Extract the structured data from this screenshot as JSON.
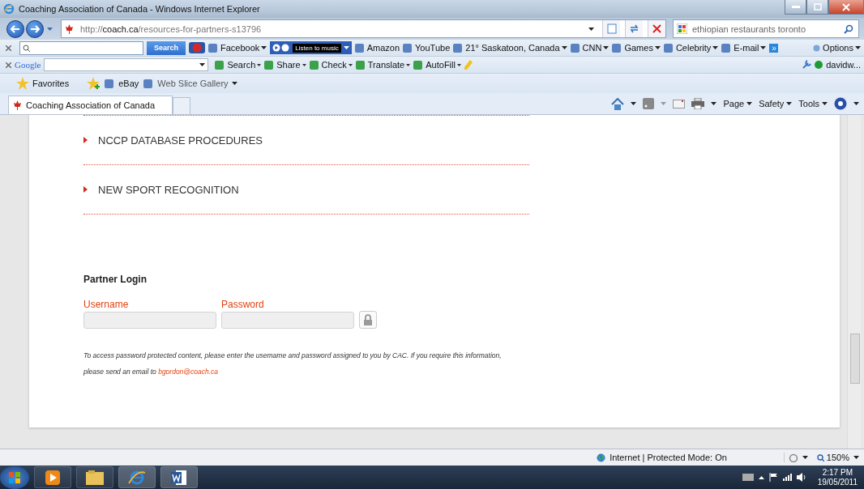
{
  "window": {
    "title": "Coaching Association of Canada - Windows Internet Explorer"
  },
  "address_bar": {
    "url_prefix": "http://",
    "url_host": "coach.ca",
    "url_path": "/resources-for-partners-s13796"
  },
  "search_box": {
    "value": "ethiopian restaurants toronto"
  },
  "toolbar_1": {
    "search_button": "Search",
    "items": [
      {
        "label": "Facebook",
        "dropdown": true
      },
      {
        "label": "Listen to music",
        "dropdown": true,
        "kind": "player"
      },
      {
        "label": "Amazon",
        "dropdown": false
      },
      {
        "label": "YouTube",
        "dropdown": false
      },
      {
        "label": "21° Saskatoon, Canada",
        "dropdown": true
      },
      {
        "label": "CNN",
        "dropdown": true
      },
      {
        "label": "Games",
        "dropdown": true
      },
      {
        "label": "Celebrity",
        "dropdown": true
      },
      {
        "label": "E-mail",
        "dropdown": true
      }
    ],
    "more": "»",
    "options": "Options"
  },
  "toolbar_2": {
    "logo": "Google",
    "items": [
      {
        "label": "Search",
        "dropdown": true
      },
      {
        "label": "Share",
        "dropdown": true
      },
      {
        "label": "Check",
        "dropdown": true
      },
      {
        "label": "Translate",
        "dropdown": true
      },
      {
        "label": "AutoFill",
        "dropdown": true
      }
    ],
    "user": "davidw..."
  },
  "favorites_bar": {
    "favorites": "Favorites",
    "items": [
      {
        "label": "eBay",
        "dropdown": false
      },
      {
        "label": "Web Slice Gallery",
        "dropdown": true
      }
    ]
  },
  "tabs": [
    {
      "label": "Coaching Association of Canada",
      "selected": true
    }
  ],
  "command_bar": [
    "Page",
    "Safety",
    "Tools"
  ],
  "content": {
    "sections": [
      "NCCP DATABASE PROCEDURES",
      "NEW SPORT RECOGNITION"
    ],
    "login": {
      "title": "Partner Login",
      "username_label": "Username",
      "password_label": "Password",
      "note": "To access password protected content, please enter the usemame and password assigned to you by CAC.  If you require this information,",
      "note_2": "please send an email to",
      "email": "bgordon@coach.ca"
    }
  },
  "status_bar": {
    "zone": "Internet | Protected Mode: On",
    "zoom": "150%"
  },
  "taskbar": {
    "time": "2:17 PM",
    "date": "19/05/2011"
  }
}
